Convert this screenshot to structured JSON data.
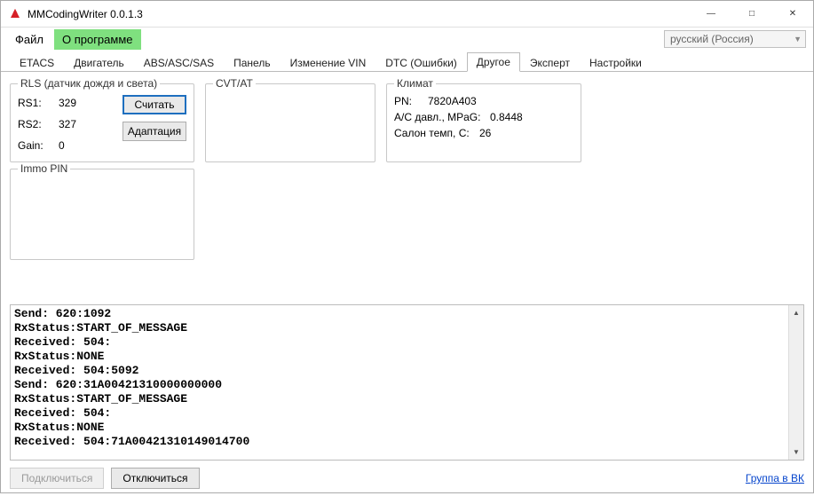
{
  "window": {
    "title": "MMCodingWriter 0.0.1.3"
  },
  "menu": {
    "file": "Файл",
    "about": "О программе"
  },
  "language": {
    "selected": "русский (Россия)"
  },
  "tabs": [
    {
      "label": "ETACS"
    },
    {
      "label": "Двигатель"
    },
    {
      "label": "ABS/ASC/SAS"
    },
    {
      "label": "Панель"
    },
    {
      "label": "Изменение VIN"
    },
    {
      "label": "DTC (Ошибки)"
    },
    {
      "label": "Другое",
      "active": true
    },
    {
      "label": "Эксперт"
    },
    {
      "label": "Настройки"
    }
  ],
  "rls": {
    "legend": "RLS (датчик дождя и света)",
    "rs1_label": "RS1:",
    "rs1_value": "329",
    "rs2_label": "RS2:",
    "rs2_value": "327",
    "gain_label": "Gain:",
    "gain_value": "0",
    "read_btn": "Считать",
    "adapt_btn": "Адаптация"
  },
  "cvt": {
    "legend": "CVT/AT"
  },
  "climate": {
    "legend": "Климат",
    "pn_label": "PN:",
    "pn_value": "7820A403",
    "ac_label": "A/C давл., MPaG:",
    "ac_value": "0.8448",
    "temp_label": "Салон темп, C:",
    "temp_value": "26"
  },
  "immo": {
    "legend": "Immo PIN"
  },
  "log": "Send: 620:1092\nRxStatus:START_OF_MESSAGE\nReceived: 504:\nRxStatus:NONE\nReceived: 504:5092\nSend: 620:31A00421310000000000\nRxStatus:START_OF_MESSAGE\nReceived: 504:\nRxStatus:NONE\nReceived: 504:71A00421310149014700",
  "footer": {
    "connect": "Подключиться",
    "disconnect": "Отключиться",
    "vk_link": "Группа в ВК"
  }
}
